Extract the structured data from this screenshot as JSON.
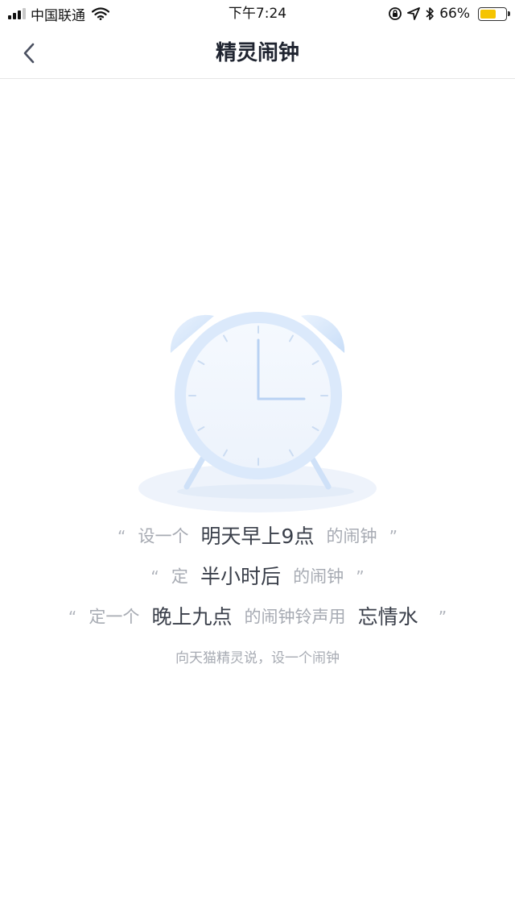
{
  "status_bar": {
    "carrier": "中国联通",
    "time": "下午7:24",
    "battery_text": "66%",
    "battery_level": 0.66,
    "battery_color": "#f5c400"
  },
  "nav": {
    "back_icon": "chevron-left-icon",
    "title": "精灵闹钟"
  },
  "illustration": {
    "icon": "alarm-clock-icon",
    "accent_color": "#cfe3fa"
  },
  "examples": [
    {
      "open": "“",
      "pre": "设一个",
      "em1": "明天早上9点",
      "post": "的闹钟",
      "em2": "",
      "close": "”"
    },
    {
      "open": "“",
      "pre": "定",
      "em1": "半小时后",
      "post": "的闹钟",
      "em2": "",
      "close": "”"
    },
    {
      "open": "“",
      "pre": "定一个",
      "em1": "晚上九点",
      "post": "的闹钟铃声用",
      "em2": "忘情水",
      "close": "”"
    }
  ],
  "hint": "向天猫精灵说，设一个闹钟"
}
